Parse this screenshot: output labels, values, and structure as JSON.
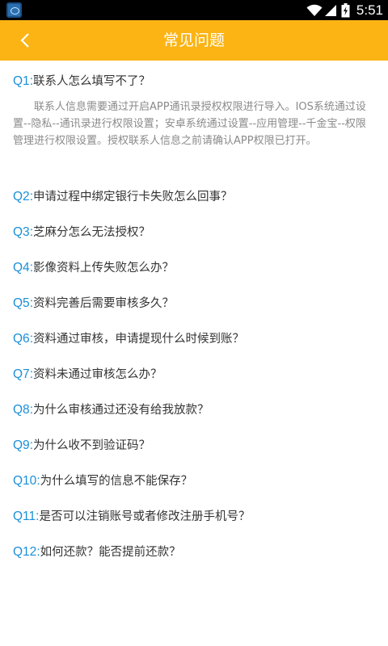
{
  "statusbar": {
    "time": "5:51"
  },
  "header": {
    "title": "常见问题"
  },
  "faqs": [
    {
      "num": "Q1",
      "sep": ":",
      "question": "联系人怎么填写不了？",
      "answer": "联系人信息需要通过开启APP通讯录授权权限进行导入。IOS系统通过设置--隐私--通讯录进行权限设置；安卓系统通过设置--应用管理--千金宝--权限管理进行权限设置。授权联系人信息之前请确认APP权限已打开。"
    },
    {
      "num": "Q2",
      "sep": ":",
      "question": "申请过程中绑定银行卡失败怎么回事？"
    },
    {
      "num": "Q3",
      "sep": ":",
      "question": "芝麻分怎么无法授权？"
    },
    {
      "num": "Q4",
      "sep": ":",
      "question": "影像资料上传失败怎么办？"
    },
    {
      "num": "Q5",
      "sep": ":",
      "question": "资料完善后需要审核多久？"
    },
    {
      "num": "Q6",
      "sep": ":",
      "question": "资料通过审核，申请提现什么时候到账？"
    },
    {
      "num": "Q7",
      "sep": ":",
      "question": "资料未通过审核怎么办？"
    },
    {
      "num": "Q8",
      "sep": ":",
      "question": "为什么审核通过还没有给我放款？"
    },
    {
      "num": "Q9",
      "sep": ":",
      "question": "为什么收不到验证码？"
    },
    {
      "num": "Q10",
      "sep": ":",
      "question": "为什么填写的信息不能保存？"
    },
    {
      "num": "Q11",
      "sep": ":",
      "question": "是否可以注销账号或者修改注册手机号？"
    },
    {
      "num": "Q12",
      "sep": ":",
      "question": "如何还款？能否提前还款？"
    }
  ]
}
